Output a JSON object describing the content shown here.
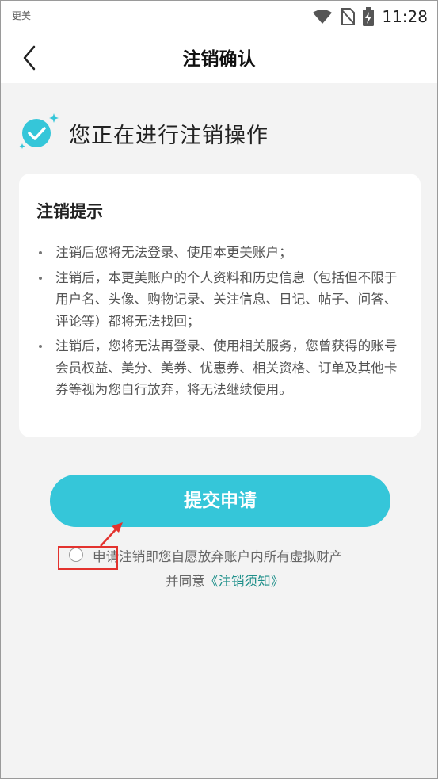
{
  "status_bar": {
    "app_name": "更美",
    "time": "11:28"
  },
  "nav": {
    "title": "注销确认"
  },
  "heading": {
    "text": "您正在进行注销操作"
  },
  "card": {
    "title": "注销提示",
    "items": [
      "注销后您将无法登录、使用本更美账户；",
      "注销后，本更美账户的个人资料和历史信息（包括但不限于用户名、头像、购物记录、关注信息、日记、帖子、问答、评论等）都将无法找回；",
      "注销后，您将无法再登录、使用相关服务，您曾获得的账号会员权益、美分、美券、优惠券、相关资格、订单及其他卡券等视为您自行放弃，将无法继续使用。"
    ]
  },
  "submit": {
    "label": "提交申请"
  },
  "agreement": {
    "line1": "申请注销即您自愿放弃账户内所有虚拟财产",
    "line2_prefix": "并同意",
    "link_text": "《注销须知》"
  },
  "colors": {
    "accent": "#35c6d9",
    "link": "#1e8f8a",
    "annotation": "#e3322e"
  },
  "icons": {
    "back": "chevron-left-icon",
    "check": "check-circle-icon",
    "wifi": "wifi-icon",
    "sim": "no-sim-icon",
    "battery": "battery-charging-icon"
  }
}
